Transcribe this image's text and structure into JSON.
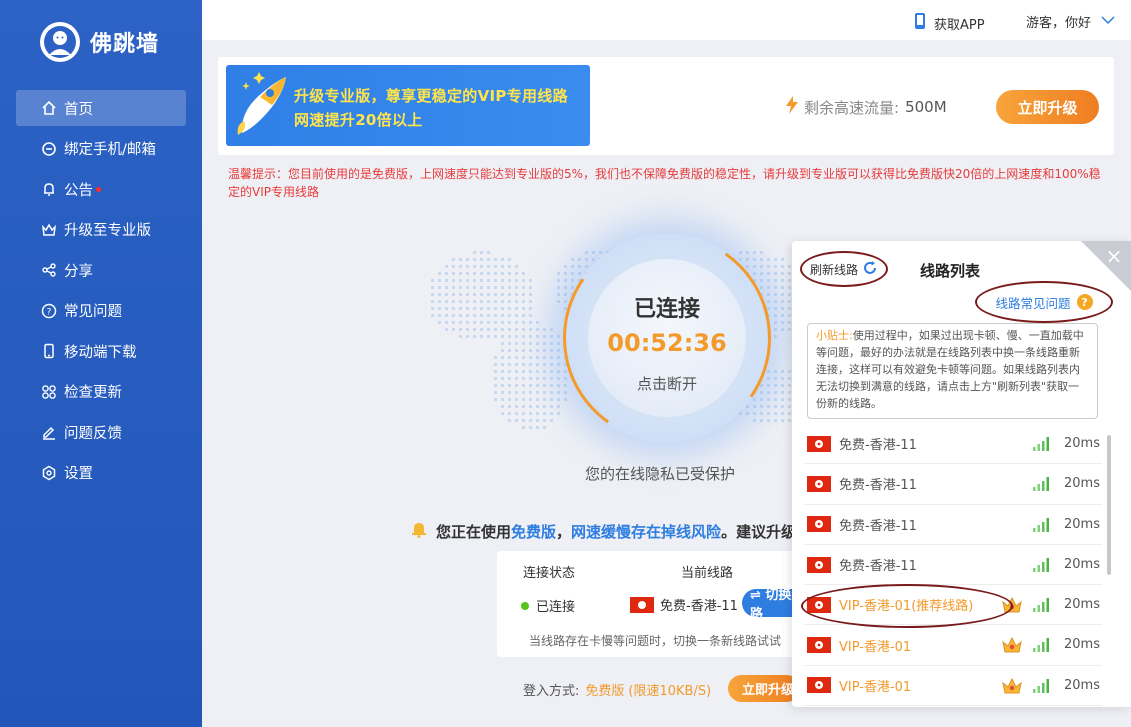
{
  "app": {
    "name": "佛跳墙"
  },
  "sidebar": {
    "items": [
      {
        "label": "首页",
        "icon": "home-icon",
        "active": true
      },
      {
        "label": "绑定手机/邮箱",
        "icon": "bind-icon"
      },
      {
        "label": "公告",
        "icon": "bell-icon",
        "badge": true
      },
      {
        "label": "升级至专业版",
        "icon": "crown-icon"
      },
      {
        "label": "分享",
        "icon": "share-icon"
      },
      {
        "label": "常见问题",
        "icon": "question-icon"
      },
      {
        "label": "移动端下载",
        "icon": "phone-icon"
      },
      {
        "label": "检查更新",
        "icon": "update-icon"
      },
      {
        "label": "问题反馈",
        "icon": "edit-icon"
      },
      {
        "label": "设置",
        "icon": "gear-icon"
      }
    ]
  },
  "topbar": {
    "get_app": "获取APP",
    "user": "游客，你好"
  },
  "banner": {
    "promo_line1": "升级专业版，尊享更稳定的VIP专用线路",
    "promo_line2": "网速提升20倍以上",
    "flow_label": "剩余高速流量:",
    "flow_value": "500M",
    "upgrade_label": "立即升级"
  },
  "warning": "温馨提示：您目前使用的是免费版，上网速度只能达到专业版的5%，我们也不保障免费版的稳定性，请升级到专业版可以获得比免费版快20倍的上网速度和100%稳定的VIP专用线路",
  "dial": {
    "status": "已连接",
    "time": "00:52:36",
    "action": "点击断开"
  },
  "privacy": "您的在线隐私已受保护",
  "notice": {
    "prefix": "您正在使用",
    "free": "免费版",
    "sep": "，",
    "slow": "网速缓慢存在掉线风险",
    "suffix": "。建议升级"
  },
  "connection": {
    "status_header": "连接状态",
    "route_header": "当前线路",
    "status": "已连接",
    "route": "免费-香港-11",
    "switch_label": "⇌ 切换线路",
    "tip": "当线路存在卡慢等问题时，切换一条新线路试试"
  },
  "login": {
    "label": "登入方式:",
    "value": "免费版",
    "speed": "(限速10KB/S)",
    "upgrade": "立即升级"
  },
  "panel": {
    "refresh": "刷新线路",
    "title": "线路列表",
    "faq": "线路常见问题",
    "tips_label": "小贴士:",
    "tips_text": "使用过程中，如果过出现卡顿、慢、一直加载中等问题，最好的办法就是在线路列表中换一条线路重新连接，这样可以有效避免卡顿等问题。如果线路列表内无法切换到满意的线路，请点击上方\"刷新列表\"获取一份新的线路。",
    "routes": [
      {
        "name": "免费-香港-11",
        "latency": "20ms",
        "vip": false
      },
      {
        "name": "免费-香港-11",
        "latency": "20ms",
        "vip": false
      },
      {
        "name": "免费-香港-11",
        "latency": "20ms",
        "vip": false
      },
      {
        "name": "免费-香港-11",
        "latency": "20ms",
        "vip": false
      },
      {
        "name": "VIP-香港-01(推荐线路)",
        "latency": "20ms",
        "vip": true
      },
      {
        "name": "VIP-香港-01",
        "latency": "20ms",
        "vip": true
      },
      {
        "name": "VIP-香港-01",
        "latency": "20ms",
        "vip": true
      }
    ]
  },
  "colors": {
    "sidebar": "#2c62c5",
    "accent": "#2e7de0",
    "orange": "#f39a2b",
    "warning": "#e83a3a",
    "annotation": "#7a1a1a"
  }
}
